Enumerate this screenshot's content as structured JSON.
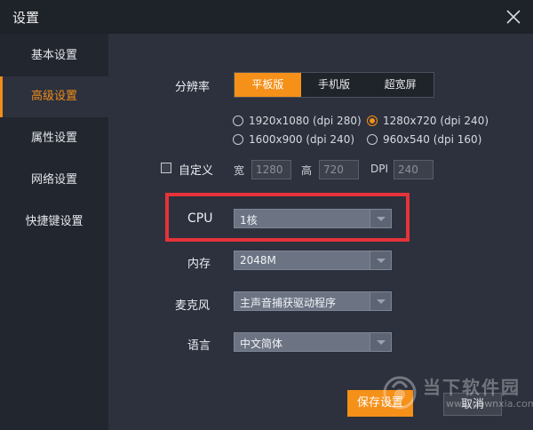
{
  "window": {
    "title": "设置"
  },
  "sidebar": {
    "items": [
      {
        "label": "基本设置",
        "active": false
      },
      {
        "label": "高级设置",
        "active": true
      },
      {
        "label": "属性设置",
        "active": false
      },
      {
        "label": "网络设置",
        "active": false
      },
      {
        "label": "快捷键设置",
        "active": false
      }
    ]
  },
  "resolution": {
    "label": "分辨率",
    "modes": [
      {
        "label": "平板版",
        "selected": true
      },
      {
        "label": "手机版",
        "selected": false
      },
      {
        "label": "超宽屏",
        "selected": false
      }
    ],
    "options": [
      {
        "label": "1920x1080 (dpi 280)",
        "checked": false
      },
      {
        "label": "1280x720 (dpi 240)",
        "checked": true
      },
      {
        "label": "1600x900 (dpi 240)",
        "checked": false
      },
      {
        "label": "960x540 (dpi 160)",
        "checked": false
      }
    ],
    "custom": {
      "label": "自定义",
      "checked": false,
      "width_label": "宽",
      "width_value": "1280",
      "height_label": "高",
      "height_value": "720",
      "dpi_label": "DPI",
      "dpi_value": "240"
    }
  },
  "cpu": {
    "label": "CPU",
    "value": "1核"
  },
  "memory": {
    "label": "内存",
    "value": "2048M"
  },
  "microphone": {
    "label": "麦克风",
    "value": "主声音捕获驱动程序"
  },
  "language": {
    "label": "语言",
    "value": "中文简体"
  },
  "actions": {
    "save_label": "保存设置",
    "cancel_label": "取消"
  },
  "watermark": {
    "text": "当下软件园",
    "url": "www.downxia.com"
  },
  "colors": {
    "accent": "#f59019",
    "highlight_box": "#e5333a",
    "background": "#2c313d",
    "sidebar": "#22262e",
    "titlebar": "#1e2229"
  }
}
